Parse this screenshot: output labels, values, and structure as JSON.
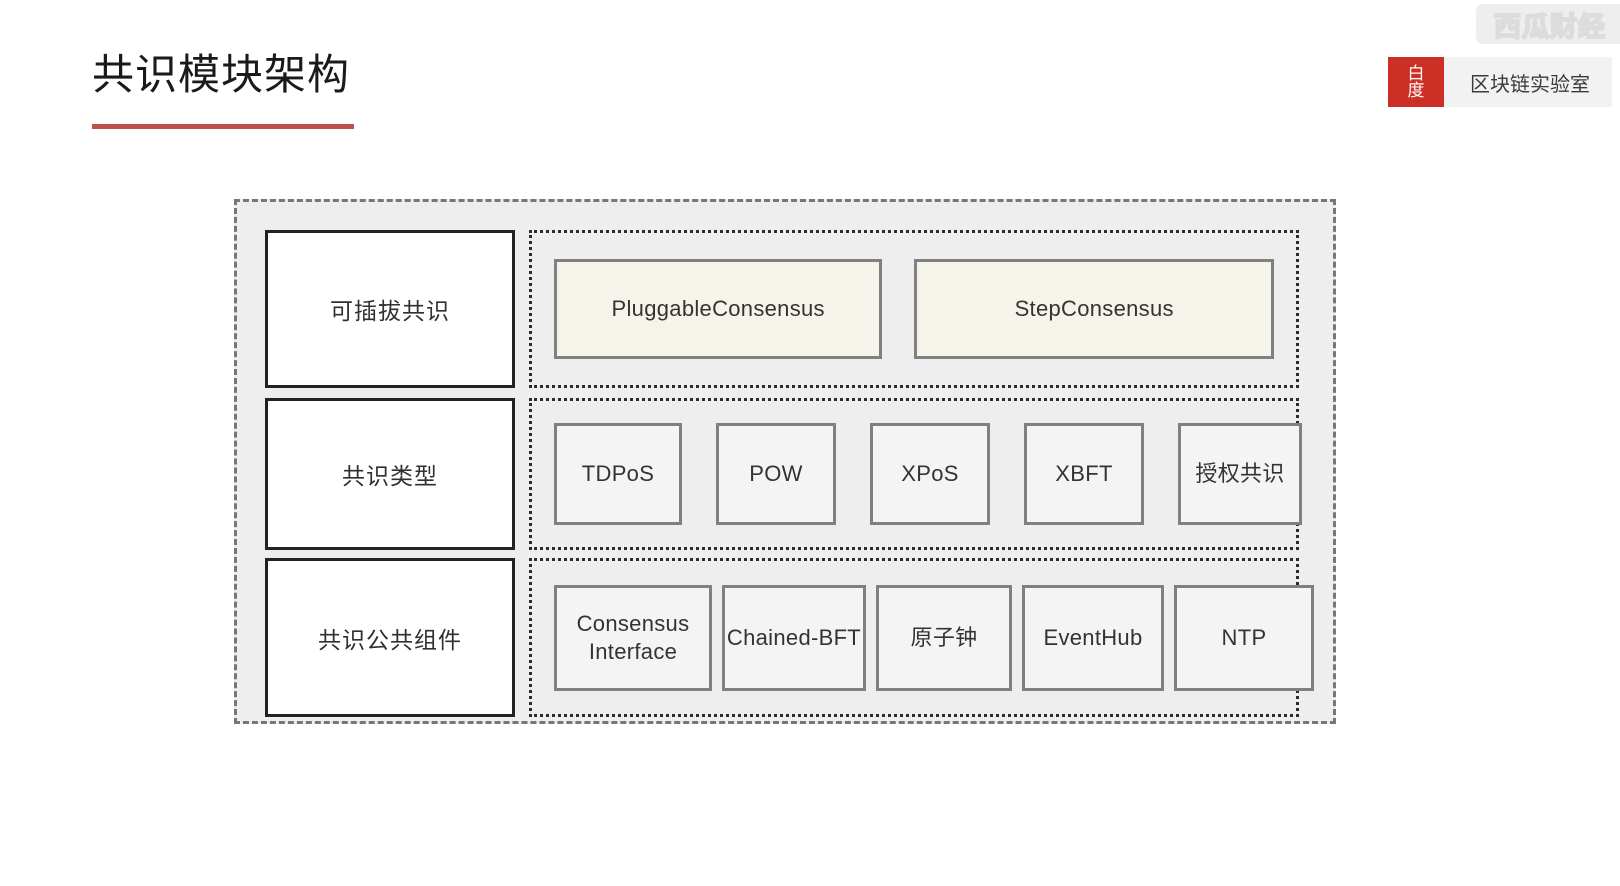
{
  "header": {
    "title": "共识模块架构",
    "accent_color": "#c0504d"
  },
  "watermark": {
    "text": "西瓜财经"
  },
  "brand": {
    "mark_line1": "白",
    "mark_line2": "度",
    "mark_color": "#cc2f25",
    "label": "区块链实验室"
  },
  "diagram": {
    "background": "#eeeeee",
    "border_color": "#777777",
    "tile_border_color": "#808080",
    "label_border_color": "#222222",
    "cream_fill": "#f6f4ea",
    "gray_fill": "#f4f4f4",
    "rows": [
      {
        "label": "可插拔共识",
        "items": [
          {
            "name": "PluggableConsensus"
          },
          {
            "name": "StepConsensus"
          }
        ]
      },
      {
        "label": "共识类型",
        "items": [
          {
            "name": "TDPoS"
          },
          {
            "name": "POW"
          },
          {
            "name": "XPoS"
          },
          {
            "name": "XBFT"
          },
          {
            "name": "授权共识"
          }
        ]
      },
      {
        "label": "共识公共组件",
        "items": [
          {
            "name": "Consensus Interface"
          },
          {
            "name": "Chained-BFT"
          },
          {
            "name": "原子钟"
          },
          {
            "name": "EventHub"
          },
          {
            "name": "NTP"
          }
        ]
      }
    ]
  }
}
